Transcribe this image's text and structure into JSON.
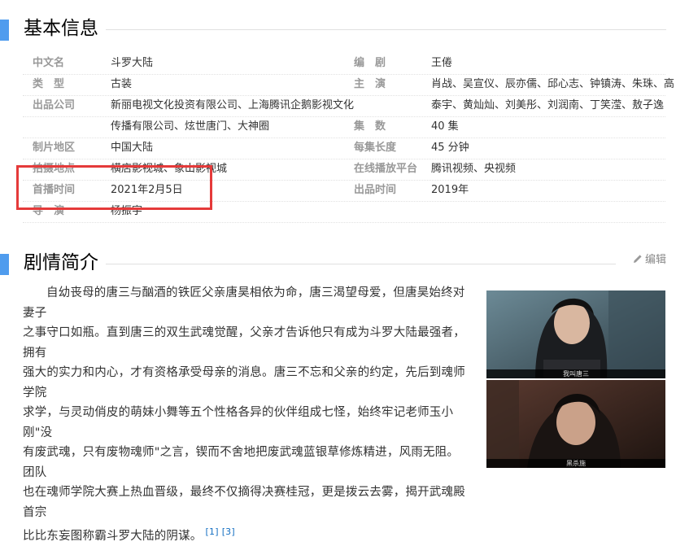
{
  "sections": {
    "basic_info": "基本信息",
    "plot": "剧情简介"
  },
  "edit_label": "编辑",
  "info": {
    "left": [
      {
        "label": "中文名",
        "value": "斗罗大陆"
      },
      {
        "label": "类　型",
        "value": "古装"
      },
      {
        "label": "出品公司",
        "value": "新丽电视文化投资有限公司、上海腾讯企鹅影视文化"
      },
      {
        "label": "",
        "value": "传播有限公司、炫世唐门、大神圈"
      },
      {
        "label": "制片地区",
        "value": "中国大陆"
      },
      {
        "label": "拍摄地点",
        "value": "横店影视城、象山影视城"
      },
      {
        "label": "首播时间",
        "value": "2021年2月5日"
      },
      {
        "label": "导　演",
        "value": "杨振宇"
      }
    ],
    "right": [
      {
        "label": "编　剧",
        "value": "王倦"
      },
      {
        "label": "主　演",
        "value": "肖战、吴宣仪、辰亦儒、邱心志、钟镇涛、朱珠、高"
      },
      {
        "label": "",
        "value": "泰宇、黄灿灿、刘美彤、刘润南、丁笑滢、敖子逸"
      },
      {
        "label": "集　数",
        "value": "40 集"
      },
      {
        "label": "每集长度",
        "value": "45 分钟"
      },
      {
        "label": "在线播放平台",
        "value": "腾讯视频、央视频"
      },
      {
        "label": "出品时间",
        "value": "2019年"
      }
    ]
  },
  "synopsis": {
    "lines": [
      "自幼丧母的唐三与酗酒的铁匠父亲唐昊相依为命，唐三渴望母爱，但唐昊始终对妻子",
      "之事守口如瓶。直到唐三的双生武魂觉醒，父亲才告诉他只有成为斗罗大陆最强者，拥有",
      "强大的实力和内心，才有资格承受母亲的消息。唐三不忘和父亲的约定，先后到魂师学院",
      "求学，与灵动俏皮的萌妹小舞等五个性格各异的伙伴组成七怪，始终牢记老师玉小刚\"没",
      "有废武魂，只有废物魂师\"之言，锲而不舍地把废武魂蓝银草修炼精进，风雨无阻。团队",
      "也在魂师学院大赛上热血晋级，最终不仅摘得决赛桂冠，更是拨云去雾，揭开武魂殿首宗",
      "比比东妄图称霸斗罗大陆的阴谋。"
    ],
    "refs": [
      "[1]",
      "[3]"
    ]
  },
  "stills": [
    {
      "caption": "我叫唐三"
    },
    {
      "caption": "黑杀施"
    }
  ],
  "colors": {
    "accent_bar": "#4f9cee",
    "highlight_box": "#e53a3a",
    "link": "#136ec2",
    "label": "#999999"
  }
}
